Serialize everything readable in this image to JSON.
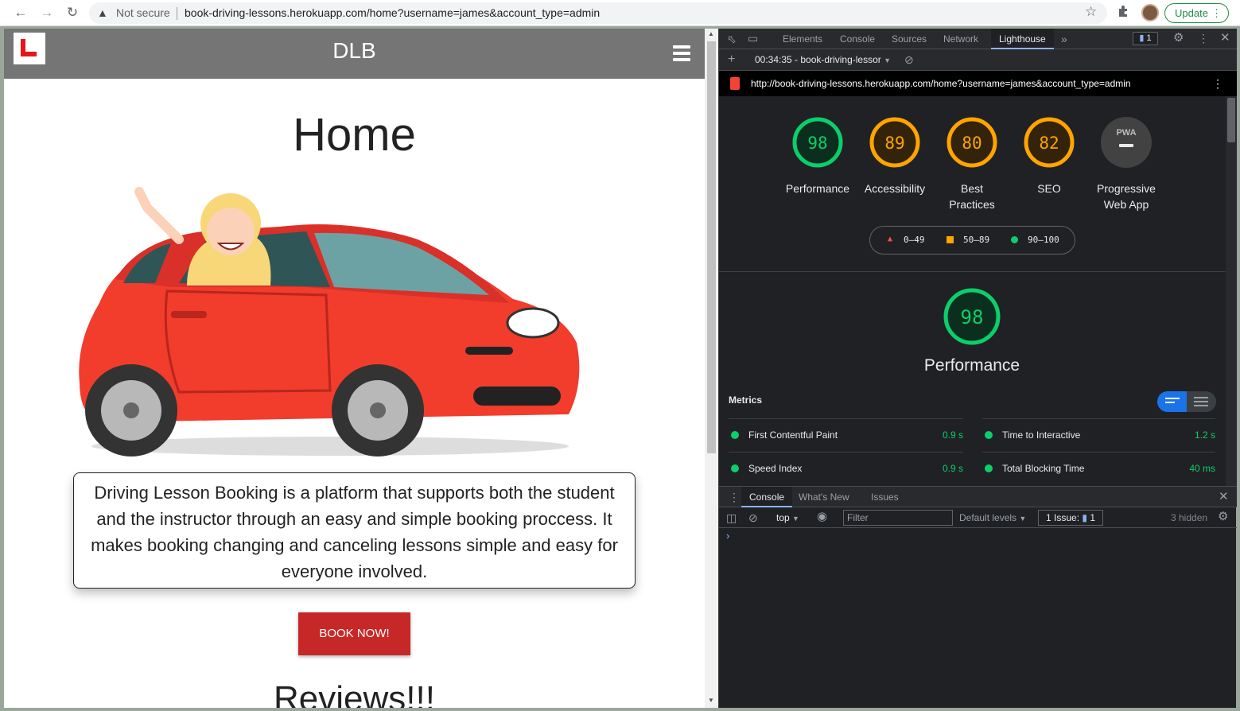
{
  "browser": {
    "security_label": "Not secure",
    "url": "book-driving-lessons.herokuapp.com/home?username=james&account_type=admin",
    "update_label": "Update"
  },
  "site": {
    "brand": "DLB",
    "home_title": "Home",
    "about_text": "Driving Lesson Booking is a platform that supports both the student and the instructor through an easy and simple booking proccess. It makes booking changing and canceling lessons simple and easy for everyone involved.",
    "cta_label": "BOOK NOW!",
    "reviews_heading": "Reviews!!!"
  },
  "devtools": {
    "tabs": [
      "Elements",
      "Console",
      "Sources",
      "Network",
      "Lighthouse"
    ],
    "active_tab": "Lighthouse",
    "issues_badge": "1",
    "report_label": "00:34:35 - book-driving-lessor",
    "lighthouse_url": "http://book-driving-lessons.herokuapp.com/home?username=james&account_type=admin",
    "scores": [
      {
        "value": "98",
        "label": "Performance",
        "color": "#0cce6b"
      },
      {
        "value": "89",
        "label": "Accessibility",
        "color": "#ffa400"
      },
      {
        "value": "80",
        "label": "Best Practices",
        "color": "#ffa400"
      },
      {
        "value": "82",
        "label": "SEO",
        "color": "#ffa400"
      },
      {
        "value": "PWA",
        "label": "Progressive Web App",
        "color": "#5f6368"
      }
    ],
    "legend": [
      {
        "range": "0–49",
        "color": "#ff4e42"
      },
      {
        "range": "50–89",
        "color": "#ffa400"
      },
      {
        "range": "90–100",
        "color": "#0cce6b"
      }
    ],
    "performance": {
      "score": "98",
      "label": "Performance",
      "metrics_title": "Metrics",
      "metrics": [
        {
          "name": "First Contentful Paint",
          "value": "0.9 s"
        },
        {
          "name": "Time to Interactive",
          "value": "1.2 s"
        },
        {
          "name": "Speed Index",
          "value": "0.9 s"
        },
        {
          "name": "Total Blocking Time",
          "value": "40 ms"
        }
      ]
    },
    "drawer": {
      "tabs": [
        "Console",
        "What's New",
        "Issues"
      ],
      "context": "top",
      "filter_placeholder": "Filter",
      "levels": "Default levels",
      "issues_label": "1 Issue:",
      "issues_count": "1",
      "hidden": "3 hidden"
    }
  }
}
